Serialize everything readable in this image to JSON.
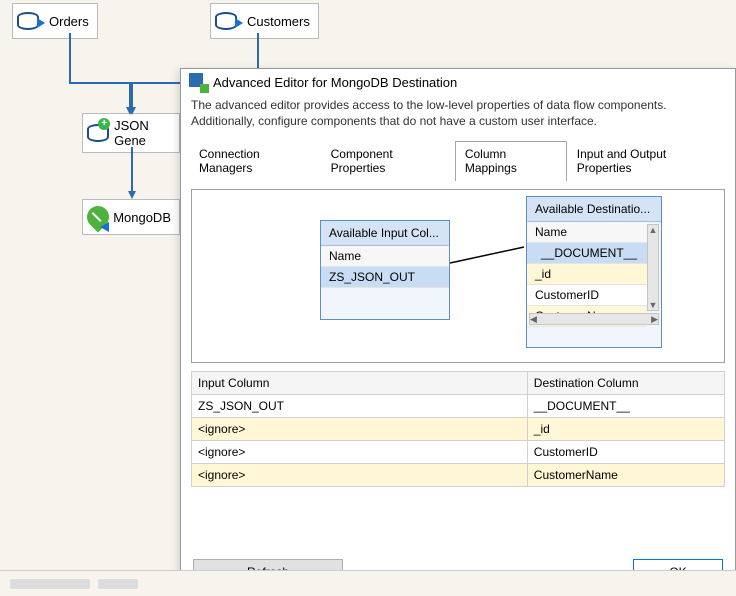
{
  "flow": {
    "orders": "Orders",
    "customers": "Customers",
    "jsonGen": "JSON Gene",
    "mongodb": "MongoDB"
  },
  "dialog": {
    "title": "Advanced Editor for MongoDB Destination",
    "description": "The advanced editor provides access to the low-level properties of data flow components. Additionally, configure components that do not have a custom user interface.",
    "tabs": [
      "Connection Managers",
      "Component Properties",
      "Column Mappings",
      "Input and Output Properties"
    ],
    "activeTab": 2,
    "inputBox": {
      "title": "Available Input Col...",
      "header": "Name",
      "items": [
        "ZS_JSON_OUT"
      ]
    },
    "destBox": {
      "title": "Available Destinatio...",
      "header": "Name",
      "items": [
        "__DOCUMENT__",
        "_id",
        "CustomerID",
        "CustomerName"
      ]
    },
    "mappingTable": {
      "headers": [
        "Input Column",
        "Destination Column"
      ],
      "rows": [
        {
          "in": "ZS_JSON_OUT",
          "out": "__DOCUMENT__",
          "ign": false
        },
        {
          "in": "<ignore>",
          "out": "_id",
          "ign": true
        },
        {
          "in": "<ignore>",
          "out": "CustomerID",
          "ign": false
        },
        {
          "in": "<ignore>",
          "out": "CustomerName",
          "ign": true
        }
      ]
    },
    "buttons": {
      "refresh": "Refresh",
      "ok": "OK"
    }
  }
}
